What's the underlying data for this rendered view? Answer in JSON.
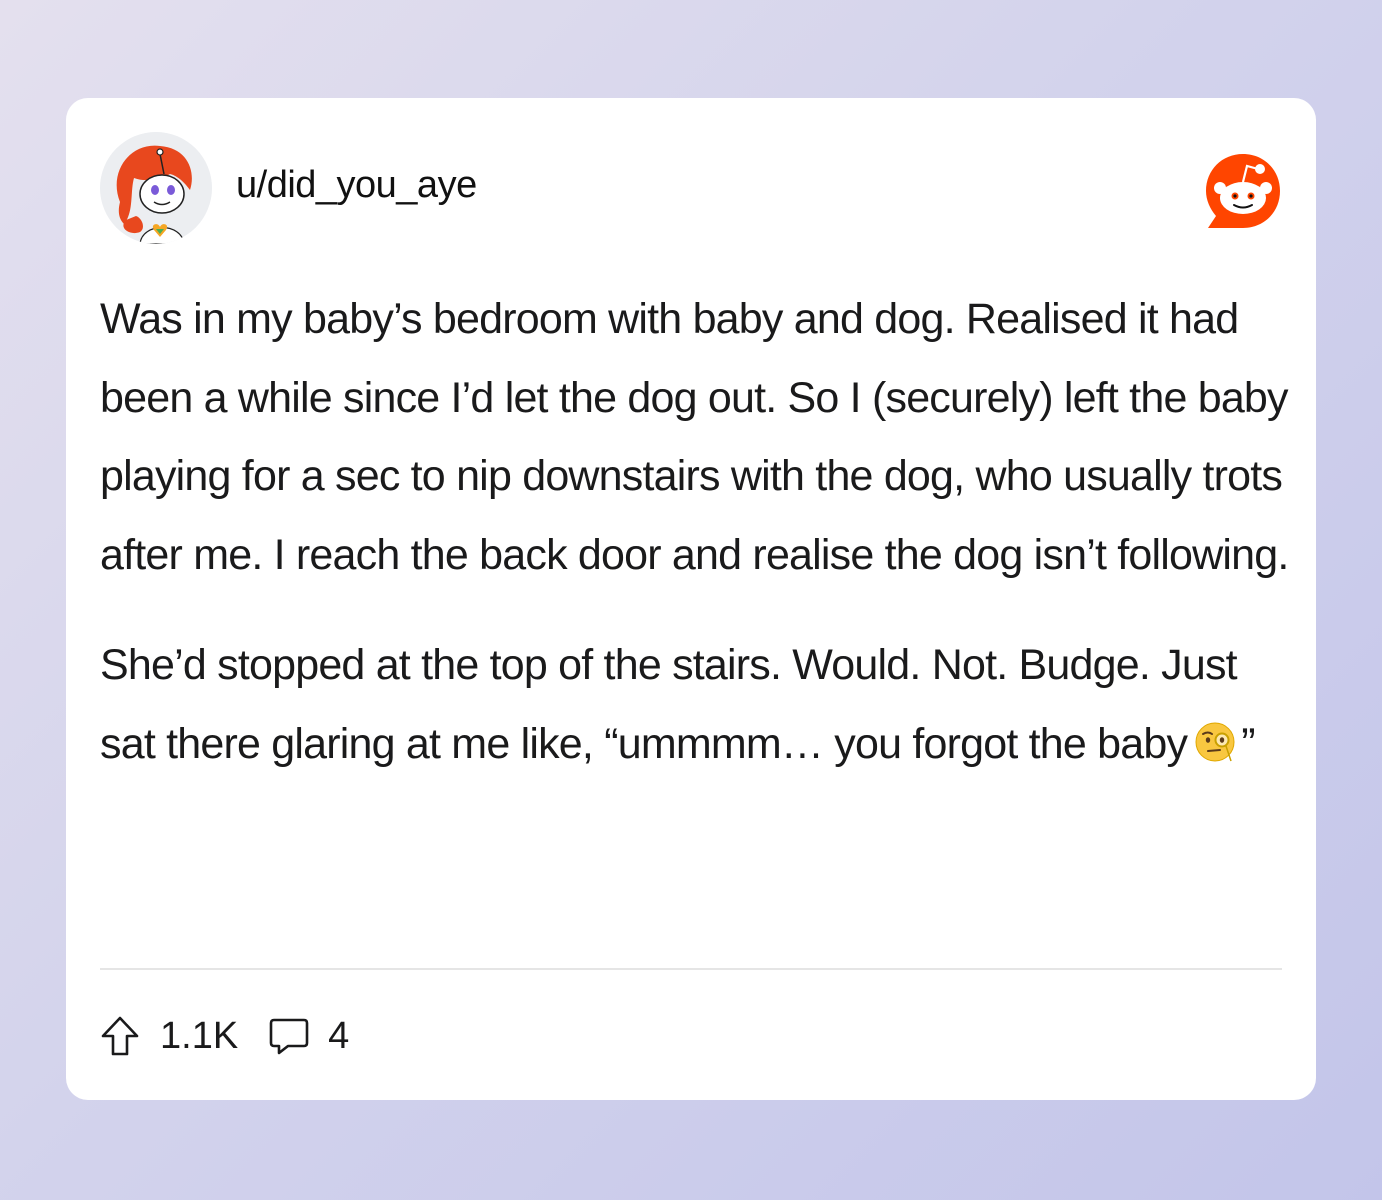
{
  "post": {
    "username": "u/did_you_aye",
    "paragraphs": [
      "Was in my baby’s bedroom with baby and dog. Realised it had been a while since I’d let the dog out. So I (securely) left the baby playing for a sec to nip downstairs with the dog, who usually trots after me. I reach the back door and realise the dog isn’t following.",
      "She’d stopped at the top of the stairs. Would. Not. Budge. Just sat there glaring at me like, “ummmm… you forgot the baby",
      "”"
    ],
    "emoji": "face-with-monocle-icon"
  },
  "stats": {
    "upvotes": "1.1K",
    "comments": "4"
  },
  "colors": {
    "reddit_orange": "#ff4500",
    "text": "#1a1a1b"
  }
}
